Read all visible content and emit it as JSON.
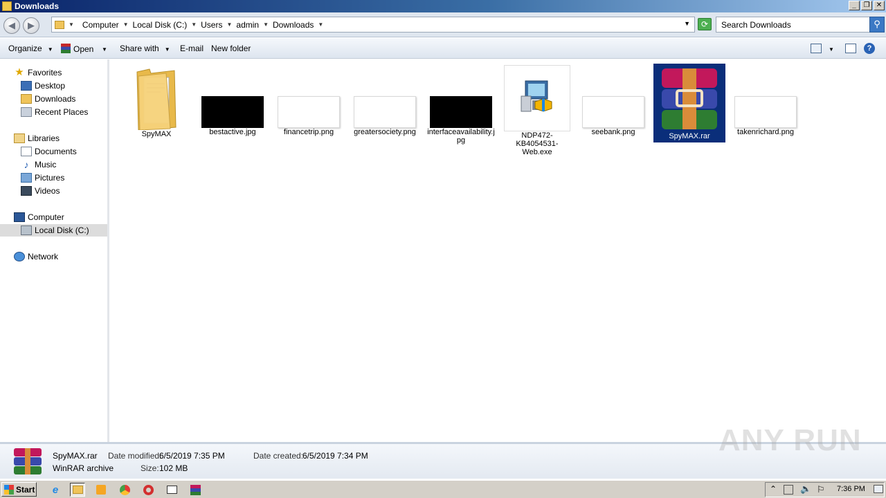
{
  "window": {
    "title": "Downloads"
  },
  "address": {
    "crumbs": [
      "Computer",
      "Local Disk (C:)",
      "Users",
      "admin",
      "Downloads"
    ],
    "search_placeholder": "Search Downloads"
  },
  "toolbar": {
    "organize": "Organize",
    "open": "Open",
    "share_with": "Share with",
    "email": "E-mail",
    "new_folder": "New folder"
  },
  "nav": {
    "favorites": "Favorites",
    "desktop": "Desktop",
    "downloads": "Downloads",
    "recent_places": "Recent Places",
    "libraries": "Libraries",
    "documents": "Documents",
    "music": "Music",
    "pictures": "Pictures",
    "videos": "Videos",
    "computer": "Computer",
    "local_disk": "Local Disk (C:)",
    "network": "Network"
  },
  "files": [
    {
      "name": "SpyMAX",
      "type": "folder"
    },
    {
      "name": "bestactive.jpg",
      "type": "image-dark"
    },
    {
      "name": "financetrip.png",
      "type": "image-light"
    },
    {
      "name": "greatersociety.png",
      "type": "image-light"
    },
    {
      "name": "interfaceavailability.jpg",
      "type": "image-dark"
    },
    {
      "name": "NDP472-KB4054531-Web.exe",
      "type": "exe"
    },
    {
      "name": "seebank.png",
      "type": "image-light"
    },
    {
      "name": "SpyMAX.rar",
      "type": "rar",
      "selected": true
    },
    {
      "name": "takenrichard.png",
      "type": "image-light"
    }
  ],
  "details": {
    "file_name": "SpyMAX.rar",
    "file_type": "WinRAR archive",
    "date_modified_label": "Date modified:",
    "date_modified": "6/5/2019 7:35 PM",
    "size_label": "Size:",
    "size": "102 MB",
    "date_created_label": "Date created:",
    "date_created": "6/5/2019 7:34 PM"
  },
  "watermark": "ANY RUN",
  "taskbar": {
    "start": "Start",
    "clock": "7:36 PM"
  }
}
